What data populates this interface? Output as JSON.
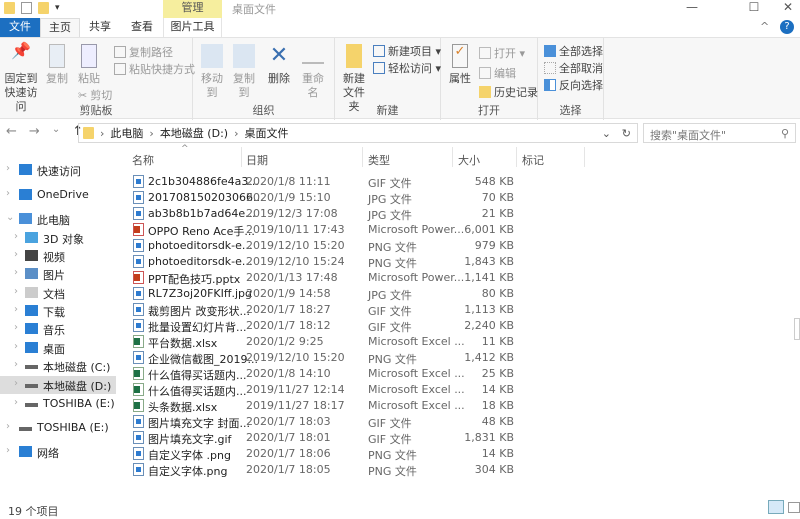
{
  "window": {
    "title": "桌面文件",
    "context_tab": "管理",
    "minimize": "—",
    "maximize": "☐",
    "close": "✕"
  },
  "tabs": {
    "file": "文件",
    "home": "主页",
    "share": "共享",
    "view": "查看",
    "picture_tools": "图片工具"
  },
  "ribbon": {
    "clipboard": {
      "label": "剪贴板",
      "pin": "固定到快速访问",
      "copy": "复制",
      "paste": "粘贴",
      "copy_path": "复制路径",
      "paste_shortcut": "粘贴快捷方式",
      "cut": "剪切"
    },
    "organize": {
      "label": "组织",
      "move_to": "移动到",
      "copy_to": "复制到",
      "delete": "删除",
      "rename": "重命名"
    },
    "new": {
      "label": "新建",
      "new_folder": "新建文件夹",
      "new_item": "新建项目 ▾",
      "easy_access": "轻松访问 ▾"
    },
    "open": {
      "label": "打开",
      "properties": "属性",
      "open": "打开 ▾",
      "edit": "编辑",
      "history": "历史记录"
    },
    "select": {
      "label": "选择",
      "select_all": "全部选择",
      "select_none": "全部取消",
      "invert": "反向选择"
    }
  },
  "address": {
    "breadcrumb": [
      "此电脑",
      "本地磁盘 (D:)",
      "桌面文件"
    ],
    "search_placeholder": "搜索\"桌面文件\""
  },
  "columns": {
    "name": "名称",
    "date": "日期",
    "type": "类型",
    "size": "大小",
    "tags": "标记"
  },
  "sidebar": [
    {
      "label": "快速访问",
      "icon": "star",
      "level": 0,
      "chev": "›"
    },
    {
      "label": "OneDrive",
      "icon": "cloud",
      "level": 0,
      "chev": "›"
    },
    {
      "label": "此电脑",
      "icon": "pc",
      "level": 0,
      "chev": "⌄"
    },
    {
      "label": "3D 对象",
      "icon": "cube",
      "level": 1,
      "chev": "›"
    },
    {
      "label": "视频",
      "icon": "video",
      "level": 1,
      "chev": "›"
    },
    {
      "label": "图片",
      "icon": "pictures",
      "level": 1,
      "chev": "›"
    },
    {
      "label": "文档",
      "icon": "documents",
      "level": 1,
      "chev": "›"
    },
    {
      "label": "下载",
      "icon": "download",
      "level": 1,
      "chev": "›"
    },
    {
      "label": "音乐",
      "icon": "music",
      "level": 1,
      "chev": "›"
    },
    {
      "label": "桌面",
      "icon": "desktop",
      "level": 1,
      "chev": "›"
    },
    {
      "label": "本地磁盘 (C:)",
      "icon": "drive",
      "level": 1,
      "chev": "›"
    },
    {
      "label": "本地磁盘 (D:)",
      "icon": "drive",
      "level": 1,
      "chev": "›",
      "selected": true
    },
    {
      "label": "TOSHIBA (E:)",
      "icon": "drive",
      "level": 1,
      "chev": "›"
    },
    {
      "label": "TOSHIBA (E:)",
      "icon": "drive",
      "level": 0,
      "chev": "›"
    },
    {
      "label": "网络",
      "icon": "network",
      "level": 0,
      "chev": "›"
    }
  ],
  "files": [
    {
      "name": "2c1b304886fe4a3...",
      "date": "2020/1/8 11:11",
      "type": "GIF 文件",
      "size": "548 KB",
      "icon": "img"
    },
    {
      "name": "201708150203066...",
      "date": "2020/1/9 15:10",
      "type": "JPG 文件",
      "size": "70 KB",
      "icon": "img"
    },
    {
      "name": "ab3b8b1b7ad64e...",
      "date": "2019/12/3 17:08",
      "type": "JPG 文件",
      "size": "21 KB",
      "icon": "img"
    },
    {
      "name": "OPPO Reno Ace手...",
      "date": "2019/10/11 17:43",
      "type": "Microsoft Power...",
      "size": "6,001 KB",
      "icon": "ppt"
    },
    {
      "name": "photoeditorsdk-e...",
      "date": "2019/12/10 15:20",
      "type": "PNG 文件",
      "size": "979 KB",
      "icon": "img"
    },
    {
      "name": "photoeditorsdk-e...",
      "date": "2019/12/10 15:24",
      "type": "PNG 文件",
      "size": "1,843 KB",
      "icon": "img"
    },
    {
      "name": "PPT配色技巧.pptx",
      "date": "2020/1/13 17:48",
      "type": "Microsoft Power...",
      "size": "1,141 KB",
      "icon": "ppt"
    },
    {
      "name": "RL7Z3oj20FKIff.jpg",
      "date": "2020/1/9 14:58",
      "type": "JPG 文件",
      "size": "80 KB",
      "icon": "img"
    },
    {
      "name": "裁剪图片 改变形状...",
      "date": "2020/1/7 18:27",
      "type": "GIF 文件",
      "size": "1,113 KB",
      "icon": "img"
    },
    {
      "name": "批量设置幻灯片背...",
      "date": "2020/1/7 18:12",
      "type": "GIF 文件",
      "size": "2,240 KB",
      "icon": "img"
    },
    {
      "name": "平台数据.xlsx",
      "date": "2020/1/2 9:25",
      "type": "Microsoft Excel ...",
      "size": "11 KB",
      "icon": "xls"
    },
    {
      "name": "企业微信截图_2019...",
      "date": "2019/12/10 15:20",
      "type": "PNG 文件",
      "size": "1,412 KB",
      "icon": "img"
    },
    {
      "name": "什么值得买话题内...",
      "date": "2020/1/8 14:10",
      "type": "Microsoft Excel ...",
      "size": "25 KB",
      "icon": "xls"
    },
    {
      "name": "什么值得买话题内...",
      "date": "2019/11/27 12:14",
      "type": "Microsoft Excel ...",
      "size": "14 KB",
      "icon": "xls"
    },
    {
      "name": "头条数据.xlsx",
      "date": "2019/11/27 18:17",
      "type": "Microsoft Excel ...",
      "size": "18 KB",
      "icon": "xls"
    },
    {
      "name": "图片填充文字 封面...",
      "date": "2020/1/7 18:03",
      "type": "GIF 文件",
      "size": "48 KB",
      "icon": "img"
    },
    {
      "name": "图片填充文字.gif",
      "date": "2020/1/7 18:01",
      "type": "GIF 文件",
      "size": "1,831 KB",
      "icon": "img"
    },
    {
      "name": "自定义字体 .png",
      "date": "2020/1/7 18:06",
      "type": "PNG 文件",
      "size": "14 KB",
      "icon": "img"
    },
    {
      "name": "自定义字体.png",
      "date": "2020/1/7 18:05",
      "type": "PNG 文件",
      "size": "304 KB",
      "icon": "img"
    }
  ],
  "status": {
    "count": "19 个项目"
  },
  "colors": {
    "accent": "#1c6fc1",
    "context": "#f6ee9e",
    "selected": "#dddddd"
  }
}
